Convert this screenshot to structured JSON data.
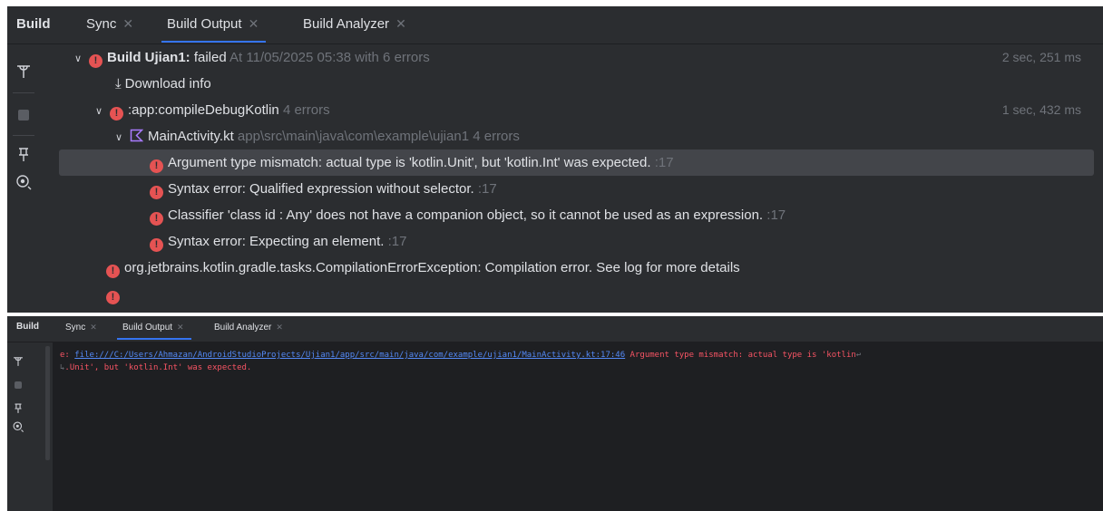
{
  "top_panel": {
    "title": "Build",
    "tabs": [
      {
        "label": "Sync"
      },
      {
        "label": "Build Output"
      },
      {
        "label": "Build Analyzer"
      }
    ],
    "tree": {
      "build_title": "Build Ujian1:",
      "build_status": "failed",
      "build_meta": "At 11/05/2025 05:38 with 6 errors",
      "build_time": "2 sec, 251 ms",
      "download_info": "Download info",
      "task_name": ":app:compileDebugKotlin",
      "task_errors": "4 errors",
      "task_time": "1 sec, 432 ms",
      "file_name": "MainActivity.kt",
      "file_path": "app\\src\\main\\java\\com\\example\\ujian1",
      "file_errors": "4 errors",
      "errors": [
        {
          "message": "Argument type mismatch: actual type is 'kotlin.Unit', but 'kotlin.Int' was expected.",
          "line": ":17"
        },
        {
          "message": "Syntax error: Qualified expression without selector.",
          "line": ":17"
        },
        {
          "message": "Classifier 'class id : Any' does not have a companion object, so it cannot be used as an expression.",
          "line": ":17"
        },
        {
          "message": "Syntax error: Expecting an element.",
          "line": ":17"
        }
      ],
      "exception": "org.jetbrains.kotlin.gradle.tasks.CompilationErrorException: Compilation error. See log for more details"
    }
  },
  "bottom_panel": {
    "title": "Build",
    "tabs": [
      {
        "label": "Sync"
      },
      {
        "label": "Build Output"
      },
      {
        "label": "Build Analyzer"
      }
    ],
    "log": {
      "prefix": "e: ",
      "link": "file:///C:/Users/Ahmazan/AndroidStudioProjects/Ujian1/app/src/main/java/com/example/ujian1/MainActivity.kt:17:46",
      "message_line1": " Argument type mismatch: actual type is 'kotlin",
      "message_line2": ".Unit', but 'kotlin.Int' was expected."
    }
  },
  "colors": {
    "panel_bg": "#2b2d30",
    "console_bg": "#1e1f22",
    "error_red": "#e55353",
    "accent_blue": "#3574f0",
    "muted_text": "#6f737a"
  }
}
